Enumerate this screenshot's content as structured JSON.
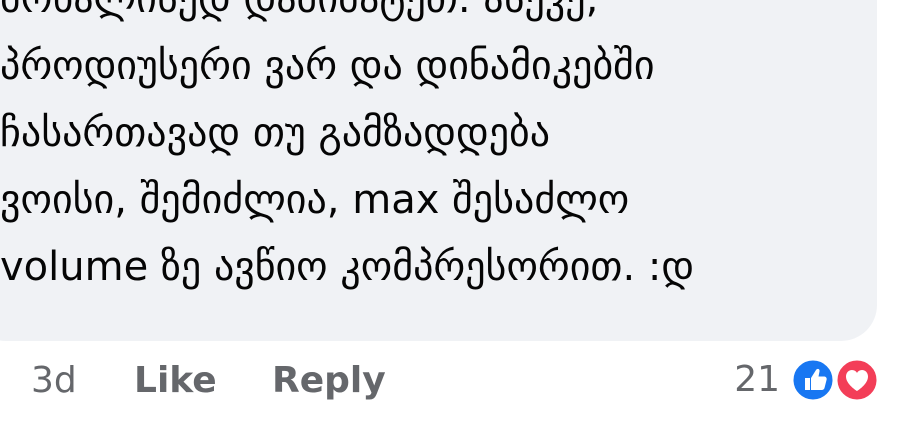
{
  "comment": {
    "lines": [
      "მოხალისედ დამიმატეთ. ასევე,",
      "პროდიუსერი ვარ და დინამიკებში",
      "ჩასართავად თუ გამზადდება",
      "ვოისი, შემიძლია, max შესაძლო",
      "volume ზე ავწიო კომპრესორით. :დ"
    ]
  },
  "actions": {
    "timestamp": "3d",
    "like_label": "Like",
    "reply_label": "Reply",
    "reaction_count": "21"
  },
  "icons": {
    "like": "like-reaction-icon",
    "love": "love-reaction-icon"
  },
  "colors": {
    "bubble_background": "#f0f2f5",
    "text": "#050505",
    "secondary_text": "#65676b",
    "like_blue": "#1877f2",
    "love_red": "#f33e58"
  }
}
